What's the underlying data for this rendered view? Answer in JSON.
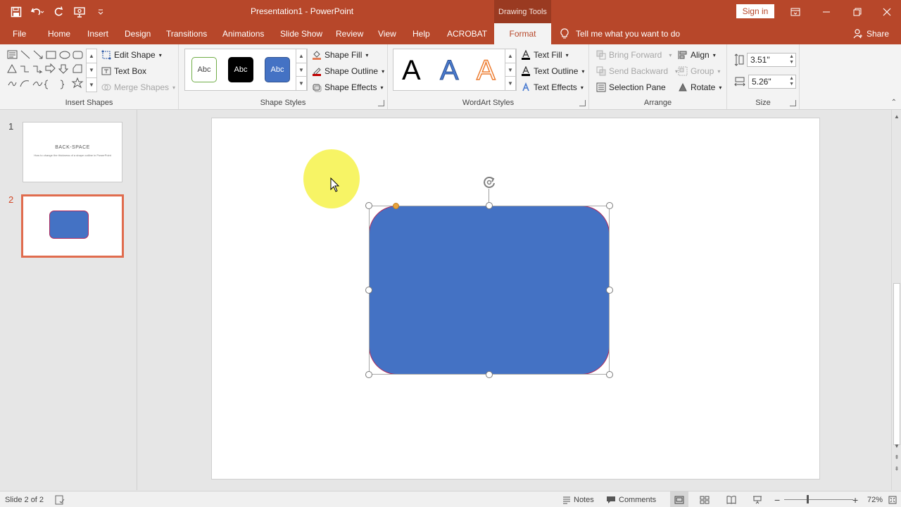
{
  "titlebar": {
    "title": "Presentation1  -  PowerPoint",
    "context_tab": "Drawing Tools",
    "signin": "Sign in"
  },
  "tabs": [
    {
      "label": "File"
    },
    {
      "label": "Home"
    },
    {
      "label": "Insert"
    },
    {
      "label": "Design"
    },
    {
      "label": "Transitions"
    },
    {
      "label": "Animations"
    },
    {
      "label": "Slide Show"
    },
    {
      "label": "Review"
    },
    {
      "label": "View"
    },
    {
      "label": "Help"
    },
    {
      "label": "ACROBAT"
    },
    {
      "label": "Format",
      "active": true
    }
  ],
  "tellme": "Tell me what you want to do",
  "share": "Share",
  "ribbon": {
    "insert_shapes": {
      "label": "Insert Shapes",
      "edit_shape": "Edit Shape",
      "text_box": "Text Box",
      "merge_shapes": "Merge Shapes"
    },
    "shape_styles": {
      "label": "Shape Styles",
      "swatches": [
        "Abc",
        "Abc",
        "Abc"
      ],
      "shape_fill": "Shape Fill",
      "shape_outline": "Shape Outline",
      "shape_effects": "Shape Effects"
    },
    "wordart_styles": {
      "label": "WordArt Styles",
      "samples": [
        "A",
        "A",
        "A"
      ],
      "text_fill": "Text Fill",
      "text_outline": "Text Outline",
      "text_effects": "Text Effects"
    },
    "arrange": {
      "label": "Arrange",
      "bring_forward": "Bring Forward",
      "send_backward": "Send Backward",
      "selection_pane": "Selection Pane",
      "align": "Align",
      "group": "Group",
      "rotate": "Rotate"
    },
    "size": {
      "label": "Size",
      "height": "3.51\"",
      "width": "5.26\""
    }
  },
  "slides": [
    {
      "number": "1",
      "title": "BACK-SPACE",
      "subtitle": "How to change the thickness of a shape outline in PowerPoint"
    },
    {
      "number": "2"
    }
  ],
  "statusbar": {
    "slide_info": "Slide 2 of 2",
    "notes": "Notes",
    "comments": "Comments",
    "zoom": "72%"
  },
  "colors": {
    "accent": "#b7472a",
    "shape_fill": "#4472c4",
    "shape_outline": "#b0285b",
    "highlight": "#f6f24a"
  }
}
